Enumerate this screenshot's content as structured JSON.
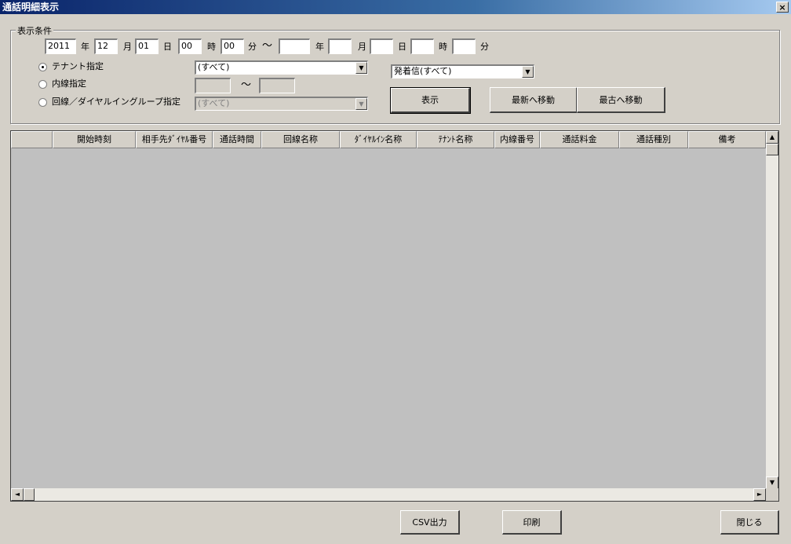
{
  "window": {
    "title": "通話明細表示",
    "close": "×"
  },
  "conditions": {
    "legend": "表示条件",
    "from": {
      "year": "2011",
      "month": "12",
      "day": "01",
      "hour": "00",
      "minute": "00"
    },
    "to": {
      "year": "",
      "month": "",
      "day": "",
      "hour": "",
      "minute": ""
    },
    "units": {
      "year": "年",
      "month": "月",
      "day": "日",
      "hour": "時",
      "minute": "分"
    },
    "tilde": "～",
    "tenant": {
      "label": "テナント指定",
      "selected": true,
      "value": "(すべて)"
    },
    "extension": {
      "label": "内線指定",
      "selected": false,
      "from": "",
      "to": "",
      "tilde": "～"
    },
    "line_group": {
      "label": "回線／ダイヤルイングループ指定",
      "selected": false,
      "value": "(すべて)"
    },
    "direction": {
      "value": "発着信(すべて)"
    },
    "display_button": "表示",
    "latest_button": "最新へ移動",
    "oldest_button": "最古へ移動"
  },
  "table": {
    "columns": [
      "",
      "開始時刻",
      "相手先ﾀﾞｲﾔﾙ番号",
      "通話時間",
      "回線名称",
      "ﾀﾞｲﾔﾙｲﾝ名称",
      "ﾃﾅﾝﾄ名称",
      "内線番号",
      "通話料金",
      "通話種別",
      "備考"
    ],
    "rows": []
  },
  "footer": {
    "csv": "CSV出力",
    "print": "印刷",
    "close": "閉じる"
  },
  "icons": {
    "dropdown": "▼",
    "up": "▲",
    "down": "▼",
    "left": "◄",
    "right": "►"
  }
}
